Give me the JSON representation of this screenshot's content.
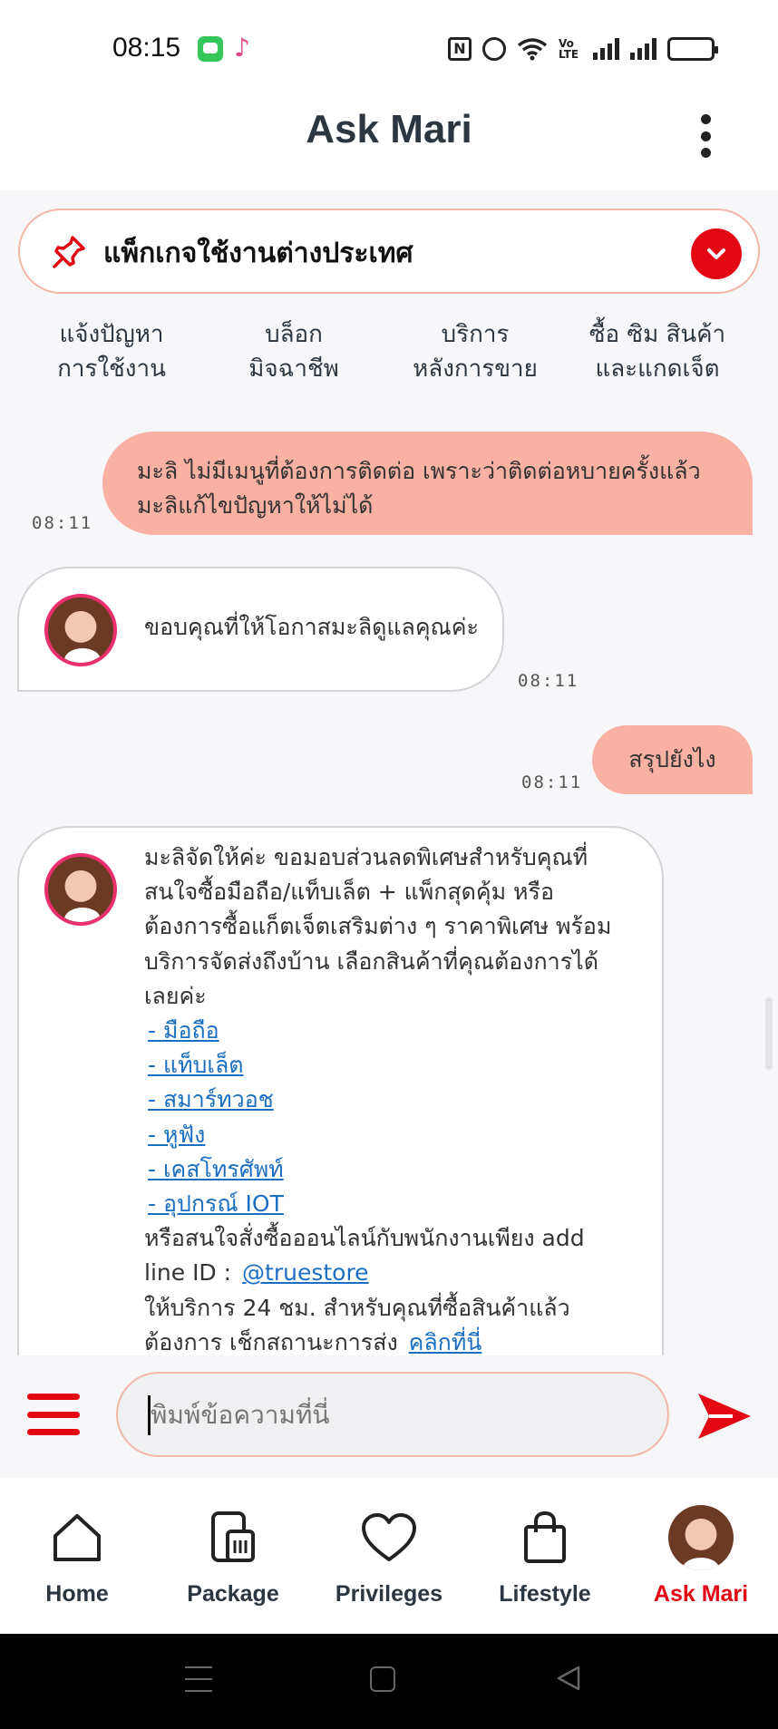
{
  "status_bar": {
    "time": "08:15",
    "icons": [
      "messages-app-icon",
      "tiktok-icon",
      "nfc-icon",
      "alarm-icon",
      "wifi-icon",
      "volte-icon",
      "signal-icon",
      "signal-icon",
      "battery-icon"
    ],
    "volte_text": "Vo LTE",
    "nfc_text": "N"
  },
  "header": {
    "title": "Ask Mari",
    "menu_icon": "more-vertical-icon"
  },
  "banner": {
    "icon": "pin-icon",
    "text": "แพ็กเกจใช้งานต่างประเทศ",
    "expand_icon": "chevron-down-icon"
  },
  "quick_menu": [
    {
      "line1": "แจ้งปัญหา",
      "line2": "การใช้งาน"
    },
    {
      "line1": "บล็อก",
      "line2": "มิจฉาชีพ"
    },
    {
      "line1": "บริการ",
      "line2": "หลังการขาย"
    },
    {
      "line1": "ซื้อ ซิม สินค้า",
      "line2": "และแกดเจ็ต"
    }
  ],
  "messages": {
    "m1": {
      "from": "user",
      "line1": "มะลิ ไม่มีเมนูที่ต้องการติดต่อ เพราะว่าติดต่อหบายครั้งแล้ว",
      "line2": "มะลิแก้ไขปัญหาให้ไม่ได้",
      "time": "08:11"
    },
    "m2": {
      "from": "bot",
      "text": "ขอบคุณที่ให้โอกาสมะลิดูแลคุณค่ะ",
      "time": "08:11"
    },
    "m3": {
      "from": "user",
      "text": "สรุปยังไง",
      "time": "08:11"
    },
    "m4": {
      "from": "bot",
      "lines": [
        "มะลิจัดให้ค่ะ ขอมอบส่วนลดพิเศษสำหรับคุณที่",
        "สนใจซื้อมือถือ/แท็บเล็ต + แพ็กสุดคุ้ม หรือ",
        "ต้องการซื้อแก็ตเจ็ตเสริมต่าง ๆ ราคาพิเศษ พร้อม",
        "บริการจัดส่งถึงบ้าน เลือกสินค้าที่คุณต้องการได้",
        "เลยค่ะ"
      ],
      "links": [
        "- มือถือ",
        "- แท็บเล็ต",
        "- สมาร์ทวอช",
        "- หูฟัง",
        "- เคสโทรศัพท์",
        "- อุปกรณ์ IOT"
      ],
      "line_after_links": "หรือสนใจสั่งซื้อออนไลน์กับพนักงานเพียง add",
      "line_id_prefix": "line ID :",
      "line_id_link": "@truestore",
      "line_service": "ให้บริการ 24 ชม. สำหรับคุณที่ซื้อสินค้าแล้ว",
      "line_track_prefix": "ต้องการ เช็กสถานะการส่ง",
      "line_track_link": "คลิกที่นี่"
    }
  },
  "input": {
    "menu_icon": "hamburger-menu-icon",
    "placeholder": "พิมพ์ข้อความที่นี่",
    "value": "",
    "send_icon": "send-icon"
  },
  "bottom_nav": [
    {
      "label": "Home",
      "icon": "home-icon",
      "active": false
    },
    {
      "label": "Package",
      "icon": "package-sim-icon",
      "active": false
    },
    {
      "label": "Privileges",
      "icon": "heart-icon",
      "active": false
    },
    {
      "label": "Lifestyle",
      "icon": "shopping-bag-icon",
      "active": false
    },
    {
      "label": "Ask Mari",
      "icon": "mari-avatar-icon",
      "active": true
    }
  ],
  "system_nav": [
    "recents-icon",
    "home-square-icon",
    "back-triangle-icon"
  ],
  "colors": {
    "accent_red": "#e30613",
    "user_bubble": "#f8b1a3",
    "banner_border": "#f3b6a7",
    "link_blue": "#1b6fc2",
    "text_dark": "#2c3640"
  }
}
